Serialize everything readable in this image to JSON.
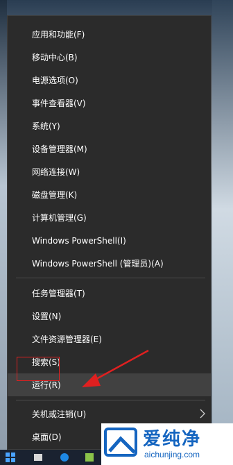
{
  "menu": {
    "items": [
      {
        "label": "应用和功能(F)"
      },
      {
        "label": "移动中心(B)"
      },
      {
        "label": "电源选项(O)"
      },
      {
        "label": "事件查看器(V)"
      },
      {
        "label": "系统(Y)"
      },
      {
        "label": "设备管理器(M)"
      },
      {
        "label": "网络连接(W)"
      },
      {
        "label": "磁盘管理(K)"
      },
      {
        "label": "计算机管理(G)"
      },
      {
        "label": "Windows PowerShell(I)"
      },
      {
        "label": "Windows PowerShell (管理员)(A)"
      },
      {
        "label": "任务管理器(T)"
      },
      {
        "label": "设置(N)"
      },
      {
        "label": "文件资源管理器(E)"
      },
      {
        "label": "搜索(S)"
      },
      {
        "label": "运行(R)"
      },
      {
        "label": "关机或注销(U)"
      },
      {
        "label": "桌面(D)"
      }
    ],
    "highlighted_item": "运行(R)"
  },
  "watermark": {
    "title": "爱纯净",
    "url": "aichunjing.com"
  },
  "colors": {
    "menu_bg": "#2b2b2b",
    "hover_bg": "#414141",
    "highlight_box": "#e02020",
    "watermark_blue": "#1565c0"
  }
}
